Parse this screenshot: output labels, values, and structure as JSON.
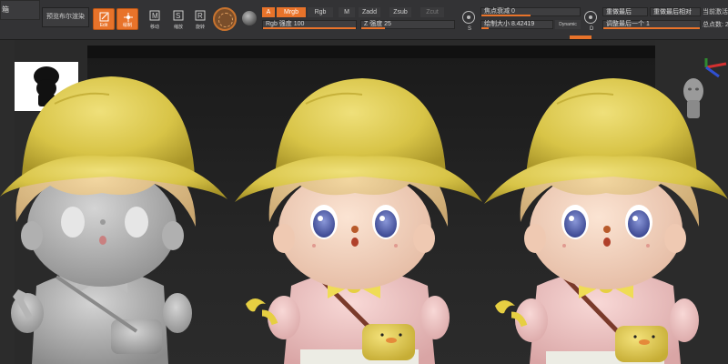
{
  "app": {
    "title_fragment": "箱"
  },
  "toolbar": {
    "preview_label": "预览布尔渲染",
    "edit_label": "Edit",
    "draw_label": "绘制",
    "move_label": "移动",
    "scale_label": "缩放",
    "rotate_label": "旋转"
  },
  "color_modes": {
    "a_label": "A",
    "mrgb_label": "Mrgb",
    "rgb_label": "Rgb",
    "m_label": "M",
    "zadd_label": "Zadd",
    "zsub_label": "Zsub",
    "zcut_label": "Zcut"
  },
  "sliders": {
    "rgb_intensity_label": "Rgb 强度 100",
    "rgb_intensity_value": 100,
    "z_intensity_label": "Z 强度 25",
    "z_intensity_value": 25,
    "focal_shift_label": "焦点衰减 0",
    "draw_size_label": "绘制大小 8.42419",
    "dynamic_label": "Dynamic",
    "s_label": "S",
    "d_label": "D"
  },
  "history": {
    "redo_last_label": "重做最后",
    "redo_last_rel_label": "重做最后相对",
    "adjust_last_label": "调整最后一个 1",
    "current_active_label": "当前激活",
    "total_points_label": "总点数: 2"
  },
  "colors": {
    "accent": "#e8732a",
    "toolbar_bg": "#333335",
    "canvas_bg": "#262626",
    "hat": "#e2cf52",
    "hair": "#e2c28a",
    "skin": "#f2d2bd",
    "shirt_pink": "#f3c8c8",
    "clay_gray": "#a9a9a9"
  },
  "figures": [
    {
      "name": "gray-clay-figure"
    },
    {
      "name": "painted-figure-center"
    },
    {
      "name": "painted-figure-right"
    }
  ]
}
